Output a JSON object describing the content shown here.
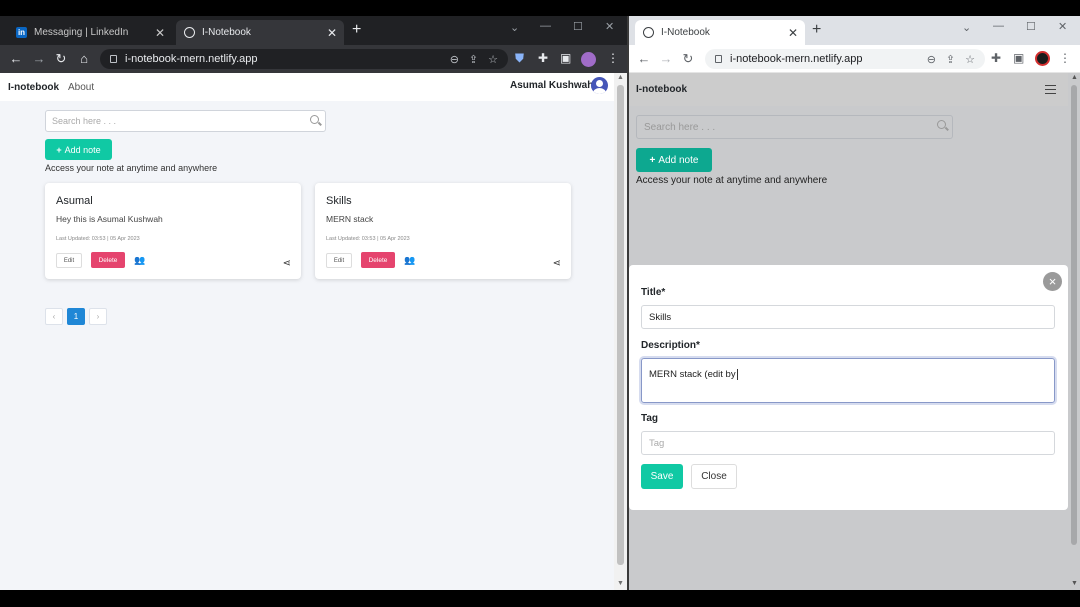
{
  "left": {
    "tabs": [
      {
        "label": "Messaging | LinkedIn",
        "icon": "linkedin-icon"
      },
      {
        "label": "I-Notebook",
        "icon": "globe-icon"
      }
    ],
    "url": "i-notebook-mern.netlify.app",
    "brand": "I-notebook",
    "nav_about": "About",
    "user_name": "Asumal Kushwah,",
    "search_placeholder": "Search here . . .",
    "add_note_label": "Add note",
    "tagline": "Access your note at anytime and anywhere",
    "notes": [
      {
        "title": "Asumal",
        "description": "Hey this is Asumal Kushwah",
        "updated": "Last Updated: 03:53 | 05 Apr 2023",
        "edit": "Edit",
        "delete": "Delete"
      },
      {
        "title": "Skills",
        "description": "MERN stack",
        "updated": "Last Updated: 03:53 | 05 Apr 2023",
        "edit": "Edit",
        "delete": "Delete"
      }
    ],
    "pager": {
      "prev": "‹",
      "current": "1",
      "next": "›"
    }
  },
  "right": {
    "tab_label": "I-Notebook",
    "url": "i-notebook-mern.netlify.app",
    "brand": "I-notebook",
    "search_placeholder": "Search here . . .",
    "add_note_label": "Add note",
    "tagline": "Access your note at anytime and anywhere",
    "modal": {
      "title_label": "Title*",
      "title_value": "Skills",
      "description_label": "Description*",
      "description_value": "MERN stack (edit by",
      "tag_label": "Tag",
      "tag_placeholder": "Tag",
      "save_label": "Save",
      "close_label": "Close",
      "close_glyph": "×"
    },
    "pager": {
      "prev": "‹",
      "current": "1",
      "next": "›"
    }
  },
  "colors": {
    "accent": "#10c9a4",
    "danger": "#e5446e",
    "page_active": "#1f87d6"
  }
}
